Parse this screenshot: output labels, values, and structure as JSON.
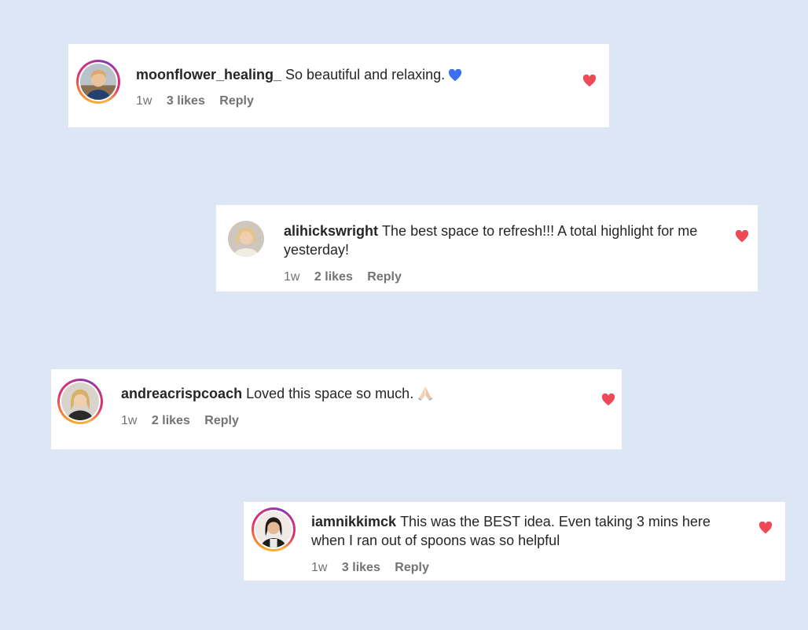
{
  "comments": [
    {
      "username": "moonflower_healing_",
      "text": "So beautiful and relaxing.",
      "emoji": "blue-heart",
      "time": "1w",
      "likes": "3 likes",
      "reply_label": "Reply",
      "liked": true,
      "avatar_ring": true
    },
    {
      "username": "alihickswright",
      "text": "The best space to refresh!!! A total highlight for me yesterday!",
      "emoji": "",
      "time": "1w",
      "likes": "2 likes",
      "reply_label": "Reply",
      "liked": true,
      "avatar_ring": false
    },
    {
      "username": "andreacrispcoach",
      "text": "Loved this space so much.",
      "emoji": "folded-hands",
      "time": "1w",
      "likes": "2 likes",
      "reply_label": "Reply",
      "liked": true,
      "avatar_ring": true
    },
    {
      "username": "iamnikkimck",
      "text": "This was the BEST idea. Even taking 3 mins here when I ran out of spoons was so helpful",
      "emoji": "",
      "time": "1w",
      "likes": "3 likes",
      "reply_label": "Reply",
      "liked": true,
      "avatar_ring": true
    }
  ],
  "colors": {
    "background": "#dce6f5",
    "card": "#ffffff",
    "heart": "#ed4956",
    "username": "#262626",
    "meta": "#737373",
    "blue_heart": "#3a6ff0"
  }
}
